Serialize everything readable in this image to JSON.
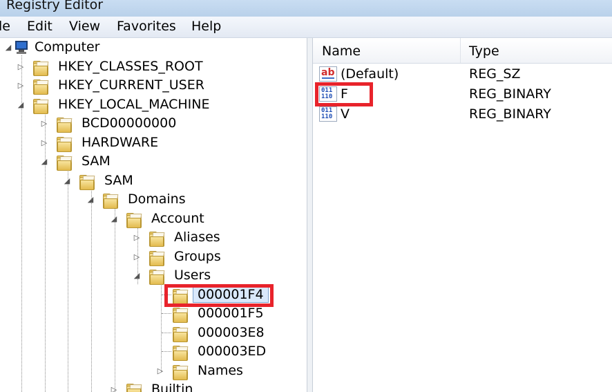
{
  "window": {
    "title": "Registry Editor"
  },
  "menu": [
    "le",
    "Edit",
    "View",
    "Favorites",
    "Help"
  ],
  "tree": {
    "root": "Computer",
    "items": [
      {
        "label": "HKEY_CLASSES_ROOT",
        "state": "collapsed"
      },
      {
        "label": "HKEY_CURRENT_USER",
        "state": "collapsed"
      },
      {
        "label": "HKEY_LOCAL_MACHINE",
        "state": "expanded"
      },
      {
        "label": "BCD00000000",
        "state": "collapsed"
      },
      {
        "label": "HARDWARE",
        "state": "collapsed"
      },
      {
        "label": "SAM",
        "state": "expanded"
      },
      {
        "label": "SAM",
        "state": "expanded"
      },
      {
        "label": "Domains",
        "state": "expanded"
      },
      {
        "label": "Account",
        "state": "expanded"
      },
      {
        "label": "Aliases",
        "state": "collapsed"
      },
      {
        "label": "Groups",
        "state": "collapsed"
      },
      {
        "label": "Users",
        "state": "expanded"
      },
      {
        "label": "000001F4",
        "state": "selected"
      },
      {
        "label": "000001F5",
        "state": "leaf"
      },
      {
        "label": "000003E8",
        "state": "leaf"
      },
      {
        "label": "000003ED",
        "state": "leaf"
      },
      {
        "label": "Names",
        "state": "collapsed"
      },
      {
        "label": "Builtin",
        "state": "collapsed"
      }
    ]
  },
  "values": {
    "columns": {
      "name": "Name",
      "type": "Type"
    },
    "rows": [
      {
        "name": "(Default)",
        "type": "REG_SZ",
        "icon": "string-value-icon"
      },
      {
        "name": "F",
        "type": "REG_BINARY",
        "icon": "binary-value-icon"
      },
      {
        "name": "V",
        "type": "REG_BINARY",
        "icon": "binary-value-icon"
      }
    ]
  },
  "icons": {
    "ab": "ab",
    "bin": "011\n110"
  },
  "colors": {
    "highlight": "#e8232b",
    "selection": "#d9e8fb"
  }
}
